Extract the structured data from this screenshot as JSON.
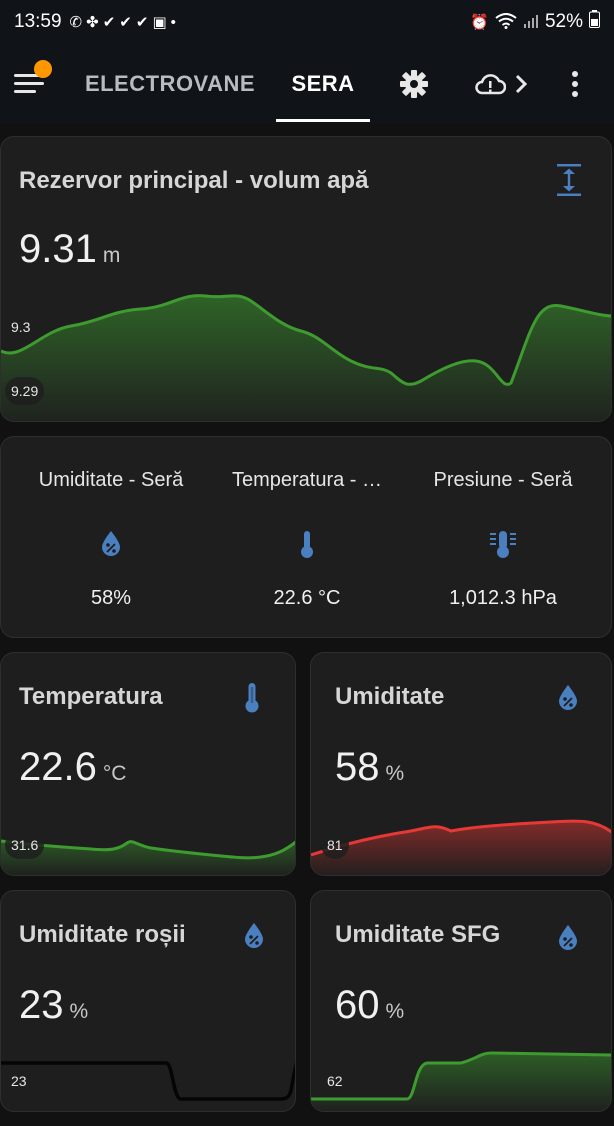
{
  "status_bar": {
    "time": "13:59",
    "notification_icons": [
      "whatsapp-icon",
      "fan-icon",
      "check-icon",
      "check-icon",
      "check-icon",
      "teams-icon",
      "dot-icon"
    ],
    "battery": "52%"
  },
  "app_bar": {
    "tabs": [
      {
        "label": "ELECTROVANE",
        "active": false
      },
      {
        "label": "SERA",
        "active": true
      }
    ],
    "icons": [
      "settings-icon",
      "cloud-alert-icon",
      "chevron-right-icon",
      "more-vert-icon"
    ],
    "menu_badge_color": "#ff9800"
  },
  "colors": {
    "accent_icon": "#4a7fc0",
    "chart_green": "#3d9b2f",
    "chart_red": "#e53935"
  },
  "reservoir_card": {
    "title": "Rezervor principal - volum apă",
    "value": "9.31",
    "unit": "m",
    "axis_top": "9.3",
    "axis_bottom": "9.29",
    "icon": "expand-vertical-icon"
  },
  "sensors_card": {
    "items": [
      {
        "name": "Umiditate - Seră",
        "icon": "water-percent-icon",
        "value": "58%"
      },
      {
        "name": "Temperatura - …",
        "icon": "thermometer-icon",
        "value": "22.6 °C"
      },
      {
        "name": "Presiune - Seră",
        "icon": "gauge-icon",
        "value": "1,012.3 hPa"
      }
    ]
  },
  "temperature_card": {
    "title": "Temperatura",
    "value": "22.6",
    "unit": "°C",
    "axis_label": "31.6",
    "icon": "thermometer-icon"
  },
  "humidity_card": {
    "title": "Umiditate",
    "value": "58",
    "unit": "%",
    "axis_label": "81",
    "icon": "water-percent-icon"
  },
  "tomato_humidity_card": {
    "title": "Umiditate roșii",
    "value": "23",
    "unit": "%",
    "axis_label": "23",
    "icon": "water-percent-icon"
  },
  "sfg_humidity_card": {
    "title": "Umiditate SFG",
    "value": "60",
    "unit": "%",
    "axis_label": "62",
    "icon": "water-percent-icon"
  }
}
